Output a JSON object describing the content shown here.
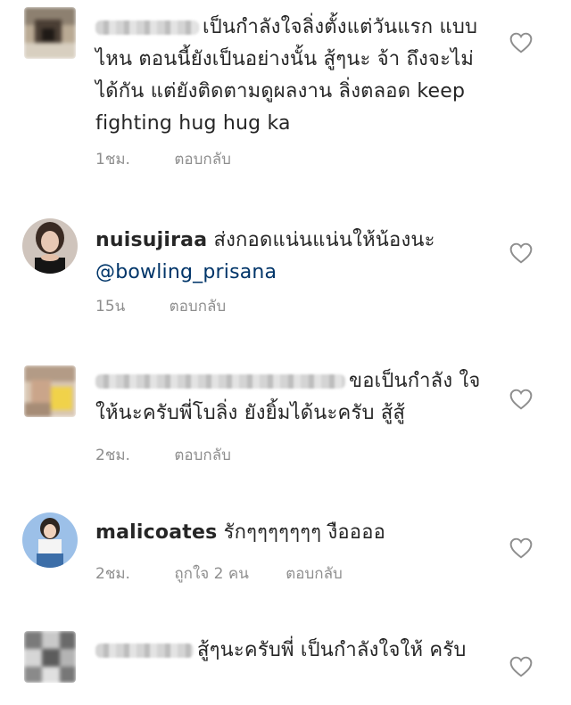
{
  "comments": [
    {
      "text": "เป็นกำลังใจลิ่งตั้งแต่วันแรก แบบไหน ตอนนี้ยังเป็นอย่างนั้น สู้ๆนะ จ้า ถึงจะไม่ได้กัน แต่ยังติดตามดูผลงาน ลิ่งตลอด keep fighting hug hug ka",
      "time": "1ชม.",
      "reply": "ตอบกลับ"
    },
    {
      "username": "nuisujiraa",
      "text": "ส่งกอดแน่นแน่นให้น้องนะ",
      "mention": "@bowling_prisana",
      "time": "15น",
      "reply": "ตอบกลับ"
    },
    {
      "text": "ขอเป็นกำลัง ใจให้นะครับพี่โบลิ่ง ยังยิ้มได้นะครับ สู้สู้",
      "time": "2ชม.",
      "reply": "ตอบกลับ"
    },
    {
      "username": "malicoates",
      "text": "รักๆๆๆๆๆๆๆ งืออออ",
      "time": "2ชม.",
      "likes": "ถูกใจ 2 คน",
      "reply": "ตอบกลับ"
    },
    {
      "text": "สู้ๆนะครับพี่ เป็นกำลังใจให้ ครับ"
    }
  ],
  "icons": {
    "like": "heart-outline-icon"
  },
  "colors": {
    "text": "#262626",
    "meta": "#8e8e8e",
    "mention": "#003569",
    "heart": "#8e8e8e"
  }
}
